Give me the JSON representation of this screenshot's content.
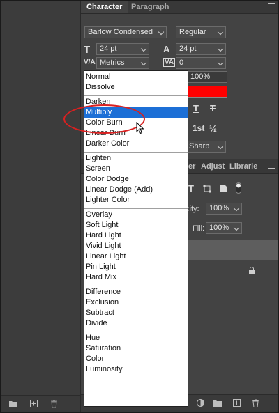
{
  "tabs": [
    "Character",
    "Paragraph"
  ],
  "font": {
    "family": "Barlow Condensed",
    "style": "Regular"
  },
  "size": {
    "font_size": "24 pt",
    "leading": "24 pt"
  },
  "kerning": {
    "kerning": "Metrics",
    "tracking": "0"
  },
  "scale": {
    "vertical": "100%"
  },
  "color": {
    "value": "#ff0000"
  },
  "text_style_icons": [
    "T",
    "T"
  ],
  "ordinal": {
    "first": "1st",
    "half": "½"
  },
  "antialias": "Sharp",
  "section_tabs": [
    "er",
    "Adjust",
    "Librarie"
  ],
  "opacity": {
    "label": "city:",
    "value": "100%"
  },
  "fill": {
    "label": "Fill:",
    "value": "100%"
  },
  "blend_groups": [
    [
      "Normal",
      "Dissolve"
    ],
    [
      "Darken",
      "Multiply",
      "Color Burn",
      "Linear Burn",
      "Darker Color"
    ],
    [
      "Lighten",
      "Screen",
      "Color Dodge",
      "Linear Dodge (Add)",
      "Lighter Color"
    ],
    [
      "Overlay",
      "Soft Light",
      "Hard Light",
      "Vivid Light",
      "Linear Light",
      "Pin Light",
      "Hard Mix"
    ],
    [
      "Difference",
      "Exclusion",
      "Subtract",
      "Divide"
    ],
    [
      "Hue",
      "Saturation",
      "Color",
      "Luminosity"
    ]
  ],
  "selected_blend": "Multiply",
  "accent": "#1c6fd6"
}
